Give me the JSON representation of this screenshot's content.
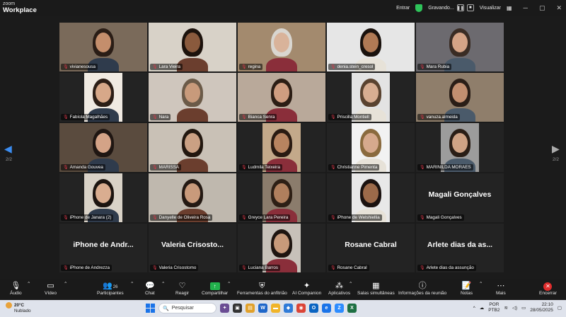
{
  "titlebar": {
    "logo_line1": "zoom",
    "logo_line2": "Workplace",
    "enter_label": "Entrar",
    "recording_label": "Gravando...",
    "view_label": "Visualizar"
  },
  "pager": {
    "left": "2/2",
    "right": "2/2"
  },
  "participants": [
    {
      "name": "vivianesousa",
      "video": true
    },
    {
      "name": "Lara Vieira",
      "video": true
    },
    {
      "name": "regina",
      "video": true
    },
    {
      "name": "denia.stein_cresol",
      "video": true
    },
    {
      "name": "Mara Rubia",
      "video": true
    },
    {
      "name": "Fabíola Magalhães",
      "video": true
    },
    {
      "name": "Nara",
      "video": true
    },
    {
      "name": "Bianca Senra",
      "video": true
    },
    {
      "name": "Priscilla Montiell",
      "video": true
    },
    {
      "name": "vanuza.almeida",
      "video": true
    },
    {
      "name": "Amanda Gouvea",
      "video": true
    },
    {
      "name": "MARISSA",
      "video": true
    },
    {
      "name": "Ludmila Teixeira",
      "video": true
    },
    {
      "name": "Christianne Pimenta",
      "video": true
    },
    {
      "name": "MARINILDA MORAES",
      "video": true
    },
    {
      "name": "iPhone de Janara (2)",
      "video": true
    },
    {
      "name": "Danyelle de Oliveira Rosa",
      "video": true
    },
    {
      "name": "Greyce Lara Pereira",
      "video": true
    },
    {
      "name": "iPhone de Welshiellia",
      "video": true
    },
    {
      "name": "Magali Gonçalves",
      "video": false,
      "display": "Magali Gonçalves"
    },
    {
      "name": "iPhone de Andrezza",
      "video": false,
      "display": "iPhone de Andr..."
    },
    {
      "name": "Valeria Crisostomo",
      "video": false,
      "display": "Valeria  Crisosto..."
    },
    {
      "name": "Luciana Barros",
      "video": true
    },
    {
      "name": "Rosane Cabral",
      "video": false,
      "display": "Rosane Cabral"
    },
    {
      "name": "Arlete dias da assunção",
      "video": false,
      "display": "Arlete dias da as..."
    }
  ],
  "toolbar": {
    "audio": "Áudio",
    "video": "Vídeo",
    "participants": "Participantes",
    "participants_count": "26",
    "chat": "Chat",
    "react": "Reagir",
    "share": "Compartilhar",
    "host_tools": "Ferramentas do anfitrião",
    "ai_companion": "AI Companion",
    "apps": "Aplicativos",
    "rooms": "Salas simultâneas",
    "info": "Informações da reunião",
    "notes": "Notas",
    "more": "Mais",
    "end": "Encerrar"
  },
  "taskbar": {
    "temp": "20°C",
    "weather": "Nublado",
    "search_placeholder": "Pesquisar",
    "lang1": "POR",
    "lang2": "PTB2",
    "time": "22:10",
    "date": "28/05/2025"
  },
  "colors": {
    "accent_blue": "#3b8cf0",
    "mic_muted": "#e0384a",
    "share_green": "#22b14c",
    "end_red": "#e02d2d"
  }
}
